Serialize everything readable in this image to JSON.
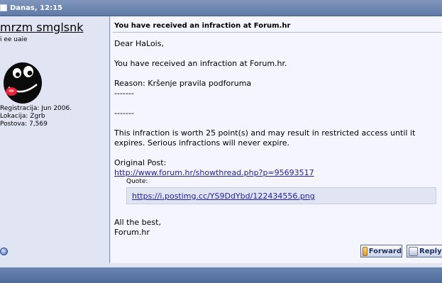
{
  "header": {
    "date_label": "Danas, 12:15"
  },
  "sender": {
    "username": "mrzm smglsnk",
    "user_title": "i ee uaie",
    "info": [
      "Registracija: Jun 2006.",
      "Lokacija: Zgrb",
      "Postova: 7,569"
    ]
  },
  "message": {
    "title": "You have received an infraction at Forum.hr",
    "greeting": "Dear HaLois,",
    "line1": "You have received an infraction at Forum.hr.",
    "reason": "Reason: Kršenje pravila podforuma",
    "separator1": "-------",
    "separator2": "-------",
    "points_text": "This infraction is worth 25 point(s) and may result in restricted access until it expires. Serious infractions will never expire.",
    "original_post_label": "Original Post:",
    "original_post_link": "http://www.forum.hr/showthread.php?p=95693517",
    "quote_label": "Quote:",
    "quote_link": "https://i.postimg.cc/YS9DdYbd/122434556.png",
    "sign_off_1": "All the best,",
    "sign_off_2": "Forum.hr"
  },
  "buttons": {
    "forward": "Forward",
    "reply": "Reply"
  },
  "colors": {
    "header_bar": "#5f79a7",
    "panel_bg": "#e1e4f2",
    "message_bg": "#f5f5ff",
    "link": "#22229c"
  }
}
